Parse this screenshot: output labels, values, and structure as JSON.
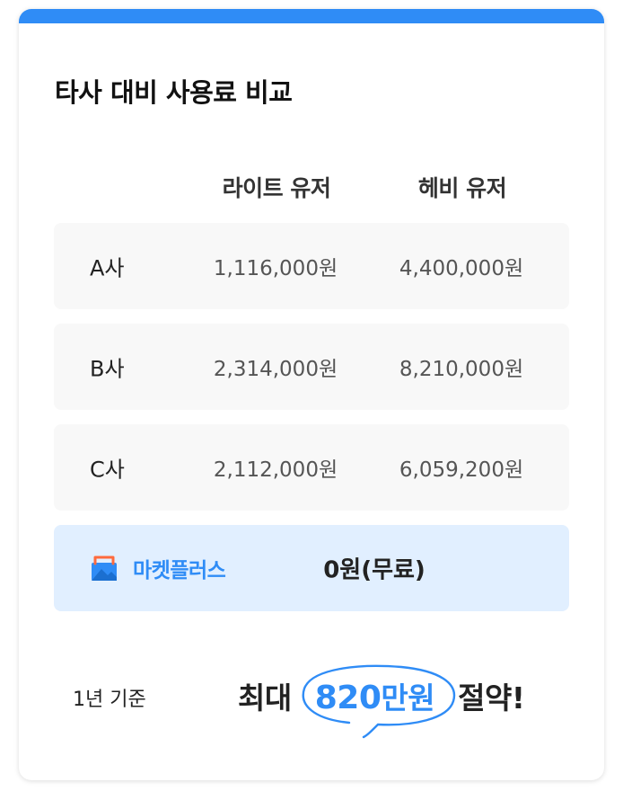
{
  "title": "타사 대비 사용료 비교",
  "columns": {
    "light": "라이트 유저",
    "heavy": "헤비 유저"
  },
  "rows": [
    {
      "company": "A사",
      "light": "1,116,000원",
      "heavy": "4,400,000원"
    },
    {
      "company": "B사",
      "light": "2,314,000원",
      "heavy": "8,210,000원"
    },
    {
      "company": "C사",
      "light": "2,112,000원",
      "heavy": "6,059,200원"
    }
  ],
  "marketplace": {
    "name": "마켓플러스",
    "price": "0원(무료)",
    "icon": "marketplace-store-icon"
  },
  "footer": {
    "basis": "1년 기준",
    "savings_prefix": "최대",
    "savings_amount": "820",
    "savings_unit": "만원",
    "savings_suffix": "절약!"
  },
  "colors": {
    "accent": "#2f8cf6",
    "row_bg": "#f8f8f8",
    "highlight_row_bg": "#e1efff",
    "icon_accent": "#ff6a3d"
  }
}
